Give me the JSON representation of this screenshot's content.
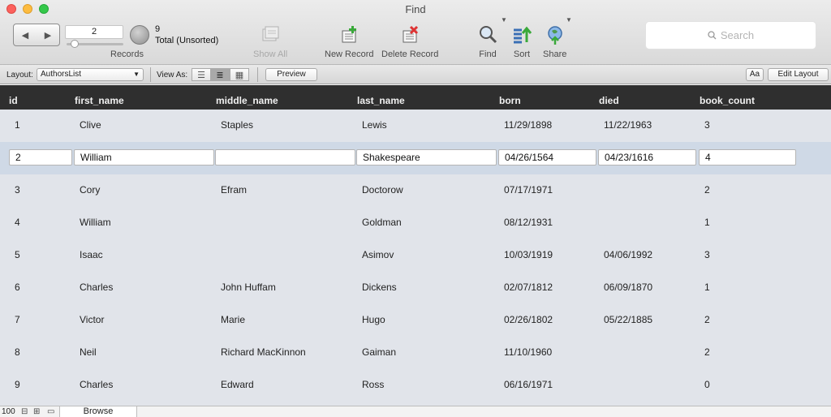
{
  "window": {
    "title": "Find"
  },
  "toolbar": {
    "current_record": "2",
    "records_label": "Records",
    "found_count": "9",
    "total_label": "Total (Unsorted)",
    "show_all": "Show All",
    "new_record": "New Record",
    "delete_record": "Delete Record",
    "find": "Find",
    "sort": "Sort",
    "share": "Share",
    "search_placeholder": "Search"
  },
  "layoutbar": {
    "layout_label": "Layout:",
    "layout_value": "AuthorsList",
    "view_as_label": "View As:",
    "preview": "Preview",
    "text_format": "Aa",
    "edit_layout": "Edit Layout"
  },
  "table": {
    "columns": [
      "id",
      "first_name",
      "middle_name",
      "last_name",
      "born",
      "died",
      "book_count"
    ],
    "rows": [
      {
        "id": "1",
        "first_name": "Clive",
        "middle_name": "Staples",
        "last_name": "Lewis",
        "born": "11/29/1898",
        "died": "11/22/1963",
        "book_count": "3"
      },
      {
        "id": "2",
        "first_name": "William",
        "middle_name": "",
        "last_name": "Shakespeare",
        "born": "04/26/1564",
        "died": "04/23/1616",
        "book_count": "4"
      },
      {
        "id": "3",
        "first_name": "Cory",
        "middle_name": "Efram",
        "last_name": "Doctorow",
        "born": "07/17/1971",
        "died": "",
        "book_count": "2"
      },
      {
        "id": "4",
        "first_name": "William",
        "middle_name": "",
        "last_name": "Goldman",
        "born": "08/12/1931",
        "died": "",
        "book_count": "1"
      },
      {
        "id": "5",
        "first_name": "Isaac",
        "middle_name": "",
        "last_name": "Asimov",
        "born": "10/03/1919",
        "died": "04/06/1992",
        "book_count": "3"
      },
      {
        "id": "6",
        "first_name": "Charles",
        "middle_name": "John Huffam",
        "last_name": "Dickens",
        "born": "02/07/1812",
        "died": "06/09/1870",
        "book_count": "1"
      },
      {
        "id": "7",
        "first_name": "Victor",
        "middle_name": "Marie",
        "last_name": "Hugo",
        "born": "02/26/1802",
        "died": "05/22/1885",
        "book_count": "2"
      },
      {
        "id": "8",
        "first_name": "Neil",
        "middle_name": "Richard MacKinnon",
        "last_name": "Gaiman",
        "born": "11/10/1960",
        "died": "",
        "book_count": "2"
      },
      {
        "id": "9",
        "first_name": "Charles",
        "middle_name": "Edward",
        "last_name": "Ross",
        "born": "06/16/1971",
        "died": "",
        "book_count": "0"
      }
    ]
  },
  "statusbar": {
    "zoom": "100",
    "mode": "Browse"
  },
  "colors": {
    "header_bg": "#2f2f2f",
    "body_bg": "#e1e4ea",
    "active_row": "#cfd9e6"
  }
}
